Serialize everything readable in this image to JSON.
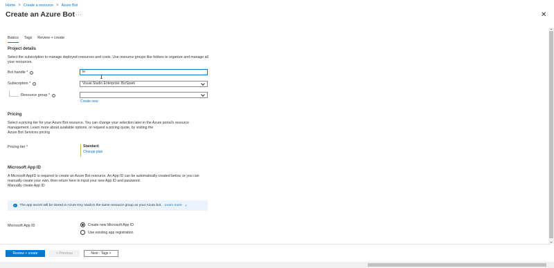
{
  "breadcrumb": {
    "items": [
      "Home",
      "Create a resource",
      "Azure Bot"
    ],
    "separator": ">"
  },
  "page": {
    "title": "Create an Azure Bot",
    "more_label": "···",
    "close_label": "✕"
  },
  "tabs": [
    {
      "label": "Basics",
      "active": true
    },
    {
      "label": "Tags",
      "active": false
    },
    {
      "label": "Review + create",
      "active": false
    }
  ],
  "project_details": {
    "title": "Project details",
    "description": "Select the subscription to manage deployed resources and costs. Use resource groups like folders to organize and manage all your resources.",
    "bot_handle": {
      "label": "Bot handle *",
      "value": "te"
    },
    "subscription": {
      "label": "Subscription *",
      "value": "Visual Studio Enterprise: BizSpark"
    },
    "resource_group": {
      "label": "Resource group *",
      "value": "",
      "create_new": "Create new"
    }
  },
  "pricing": {
    "title": "Pricing",
    "description": "Select a pricing tier for your Azure Bot resource. You can change your selection later in the Azure portal's resource management. Learn more about available options, or request a pricing quote, by visiting the",
    "link": "Azure Bot Services pricing",
    "tier_label": "Pricing tier *",
    "tier_value": "Standard",
    "change_plan": "Change plan"
  },
  "app_id": {
    "title": "Microsoft App ID",
    "description": "A Microsoft AppID is required to create an Azure Bot resource. An App ID can be automatically created below, or you can manually create your own, then return here to input your new App ID and password.",
    "manual_link": "Manually create App ID",
    "info_text": "The app secret will be stored in Azure Key Vault in the same resource group as your Azure bot.",
    "info_link": "Learn more",
    "field_label": "Microsoft App ID",
    "options": [
      {
        "label": "Create new Microsoft App ID",
        "selected": true
      },
      {
        "label": "Use existing app registration",
        "selected": false
      }
    ]
  },
  "footer": {
    "review_create": "Review + create",
    "previous": "< Previous",
    "next": "Next : Tags >"
  },
  "colors": {
    "accent": "#0078d4",
    "tier_marker": "#c2b44a"
  }
}
